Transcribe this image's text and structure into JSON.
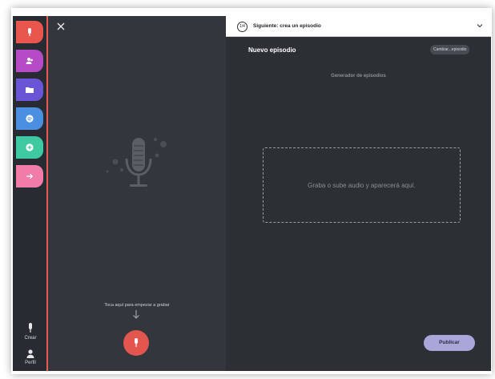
{
  "header": {
    "step_badge": "1/4",
    "step_text": "Siguiente: crea un episodio"
  },
  "episode": {
    "title": "Nuevo episodio",
    "change_label": "Cambiar...episodio",
    "generator_label": "Generador de episodios"
  },
  "recorder": {
    "tap_label": "Toca aquí para empezar a grabar"
  },
  "dropzone": {
    "text": "Graba o sube audio y aparecerá aquí."
  },
  "actions": {
    "publish_label": "Publicar"
  },
  "rail": {
    "items": [
      {
        "icon": "mic-icon",
        "color": "#e9564e"
      },
      {
        "icon": "people-icon",
        "color": "#b74ac6"
      },
      {
        "icon": "folder-icon",
        "color": "#6a55d6"
      },
      {
        "icon": "spotify-icon",
        "color": "#4a8fe0"
      },
      {
        "icon": "plus-circle-icon",
        "color": "#3fc9a1"
      },
      {
        "icon": "arrow-right-icon",
        "color": "#f07ca7"
      }
    ],
    "bottom_1_label": "Crear",
    "bottom_2_label": "Perfil"
  },
  "colors": {
    "accent_red": "#e2564d",
    "publish_bg": "#a9a6d9",
    "panel_dark": "#33363c",
    "main_dark": "#2c3035"
  }
}
